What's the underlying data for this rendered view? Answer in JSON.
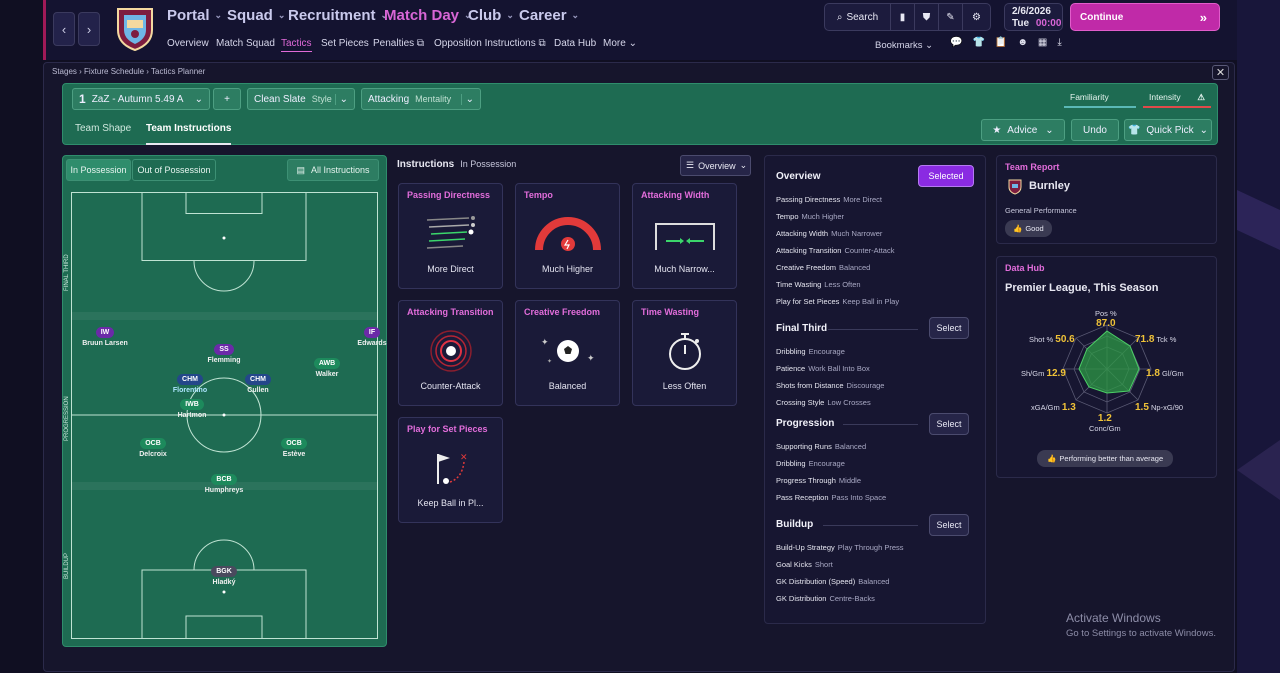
{
  "nav": {
    "back": "‹",
    "forward": "›",
    "main": [
      {
        "label": "Portal"
      },
      {
        "label": "Squad"
      },
      {
        "label": "Recruitment"
      },
      {
        "label": "Match Day"
      },
      {
        "label": "Club"
      },
      {
        "label": "Career"
      }
    ],
    "sub": [
      "Overview",
      "Match Squad",
      "Tactics",
      "Set Pieces",
      "Penalties",
      "Opposition Instructions",
      "Data Hub",
      "More"
    ],
    "search": "Search",
    "date": "2/6/2026",
    "day": "Tue",
    "time": "00:00",
    "continue": "Continue",
    "bookmarks": "Bookmarks"
  },
  "breadcrumb": [
    "Stages",
    "Fixture Schedule",
    "Tactics Planner"
  ],
  "tactic": {
    "num": "1",
    "name": "ZaZ - Autumn 5.49 A",
    "add": "+",
    "style_value": "Clean Slate",
    "style_label": "Style",
    "mentality_value": "Attacking",
    "mentality_label": "Mentality",
    "familiarity": "Familiarity",
    "intensity": "Intensity",
    "tabs": [
      "Team Shape",
      "Team Instructions"
    ],
    "advice": "Advice",
    "undo": "Undo",
    "quick_pick": "Quick Pick"
  },
  "pitch": {
    "tabs": [
      "In Possession",
      "Out of Possession"
    ],
    "all_instructions": "All Instructions",
    "zones": [
      "FINAL THIRD",
      "PROGRESSION",
      "BUILDUP"
    ],
    "players": [
      {
        "role": "IW",
        "name": "Bruun Larsen",
        "color": "#6b2aa8"
      },
      {
        "role": "IF",
        "name": "Edwards",
        "color": "#6b2aa8"
      },
      {
        "role": "SS",
        "name": "Flemming",
        "color": "#6b2aa8"
      },
      {
        "role": "AWB",
        "name": "Walker",
        "color": "#1d8a5c"
      },
      {
        "role": "CHM",
        "name": "Florentino",
        "color": "#24478a"
      },
      {
        "role": "CHM",
        "name": "Cullen",
        "color": "#24478a"
      },
      {
        "role": "IWB",
        "name": "Hartmon",
        "color": "#1d8a5c"
      },
      {
        "role": "OCB",
        "name": "Delcroix",
        "color": "#1d8a5c"
      },
      {
        "role": "OCB",
        "name": "Estève",
        "color": "#1d8a5c"
      },
      {
        "role": "BCB",
        "name": "Humphreys",
        "color": "#1d8a5c"
      },
      {
        "role": "BGK",
        "name": "Hladký",
        "color": "#4a4a5e"
      }
    ]
  },
  "instructions": {
    "title": "Instructions",
    "subtitle": "In Possession",
    "view": "Overview",
    "cards": [
      {
        "title": "Passing Directness",
        "value": "More Direct"
      },
      {
        "title": "Tempo",
        "value": "Much Higher"
      },
      {
        "title": "Attacking Width",
        "value": "Much Narrow..."
      },
      {
        "title": "Attacking Transition",
        "value": "Counter-Attack"
      },
      {
        "title": "Creative Freedom",
        "value": "Balanced"
      },
      {
        "title": "Time Wasting",
        "value": "Less Often"
      },
      {
        "title": "Play for Set Pieces",
        "value": "Keep Ball in Pl..."
      }
    ]
  },
  "overview": {
    "title": "Overview",
    "selected": "Selected",
    "select": "Select",
    "items": [
      {
        "k": "Passing Directness",
        "v": "More Direct"
      },
      {
        "k": "Tempo",
        "v": "Much Higher"
      },
      {
        "k": "Attacking Width",
        "v": "Much Narrower"
      },
      {
        "k": "Attacking Transition",
        "v": "Counter-Attack"
      },
      {
        "k": "Creative Freedom",
        "v": "Balanced"
      },
      {
        "k": "Time Wasting",
        "v": "Less Often"
      },
      {
        "k": "Play for Set Pieces",
        "v": "Keep Ball in Play"
      }
    ],
    "final_third": "Final Third",
    "final_items": [
      {
        "k": "Dribbling",
        "v": "Encourage"
      },
      {
        "k": "Patience",
        "v": "Work Ball Into Box"
      },
      {
        "k": "Shots from Distance",
        "v": "Discourage"
      },
      {
        "k": "Crossing Style",
        "v": "Low Crosses"
      }
    ],
    "progression": "Progression",
    "prog_items": [
      {
        "k": "Supporting Runs",
        "v": "Balanced"
      },
      {
        "k": "Dribbling",
        "v": "Encourage"
      },
      {
        "k": "Progress Through",
        "v": "Middle"
      },
      {
        "k": "Pass Reception",
        "v": "Pass Into Space"
      }
    ],
    "buildup": "Buildup",
    "build_items": [
      {
        "k": "Build-Up Strategy",
        "v": "Play Through Press"
      },
      {
        "k": "Goal Kicks",
        "v": "Short"
      },
      {
        "k": "GK Distribution (Speed)",
        "v": "Balanced"
      },
      {
        "k": "GK Distribution",
        "v": "Centre-Backs"
      }
    ]
  },
  "team_report": {
    "title": "Team Report",
    "team": "Burnley",
    "perf_label": "General Performance",
    "perf": "Good"
  },
  "data_hub": {
    "title": "Data Hub",
    "subtitle": "Premier League, This Season",
    "stats": [
      {
        "label": "Pos %",
        "value": "87.0"
      },
      {
        "label": "Tck %",
        "value": "71.8"
      },
      {
        "label": "Gl/Gm",
        "value": "1.8"
      },
      {
        "label": "Np-xG/90",
        "value": "1.5"
      },
      {
        "label": "Conc/Gm",
        "value": "1.2"
      },
      {
        "label": "xGA/Gm",
        "value": "1.3"
      },
      {
        "label": "Sh/Gm",
        "value": "12.9"
      },
      {
        "label": "Shot %",
        "value": "50.6"
      }
    ],
    "footer": "Performing better than average"
  },
  "watermark": {
    "line1": "Activate Windows",
    "line2": "Go to Settings to activate Windows."
  }
}
